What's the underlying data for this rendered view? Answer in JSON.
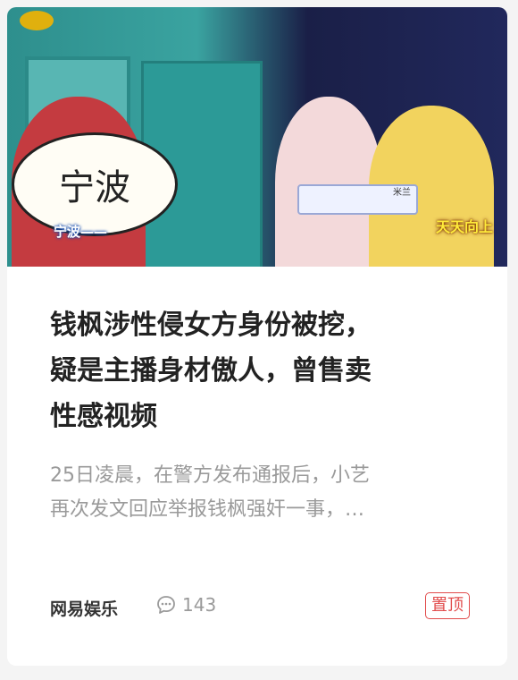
{
  "article": {
    "image": {
      "overlay_text": "宁波",
      "caption_tag": "宁波——",
      "mic_label": "米兰",
      "show_logo": "天天向上"
    },
    "title_lines": [
      "钱枫涉性侵女方身份被挖，",
      "疑是主播身材傲人，曾售卖",
      "性感视频"
    ],
    "summary_lines": [
      "25日凌晨，在警方发布通报后，小艺",
      "再次发文回应举报钱枫强奸一事，…"
    ],
    "source": "网易娱乐",
    "comment_icon": "comment-bubble-icon",
    "comment_count": "143",
    "badge": "置顶",
    "colors": {
      "badge": "#e14b4b",
      "title": "#222222",
      "summary": "#9a9a9a"
    }
  }
}
